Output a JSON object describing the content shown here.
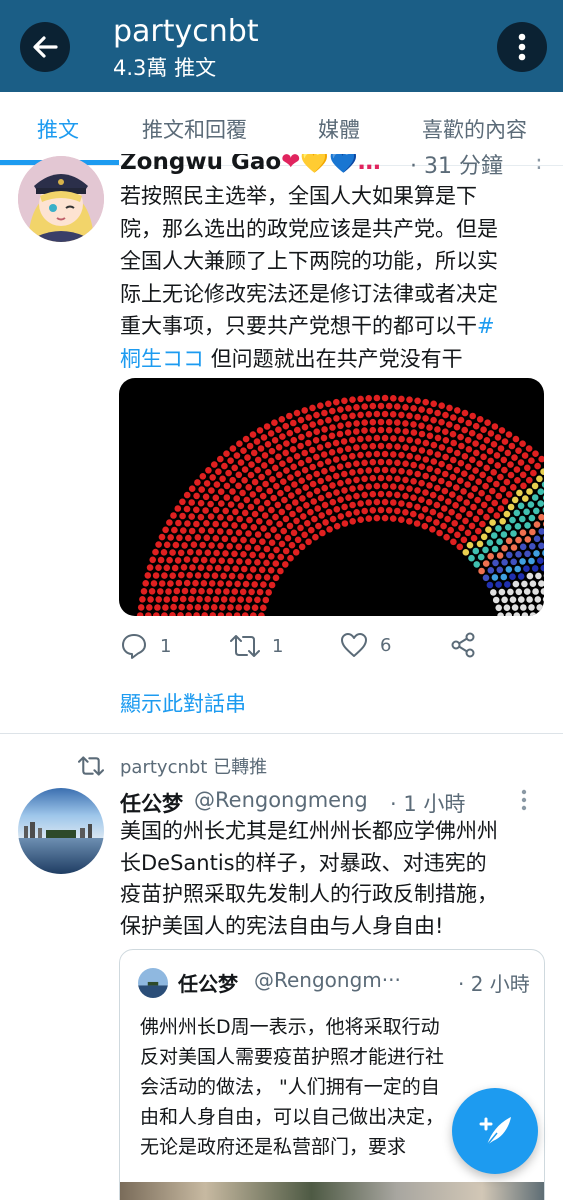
{
  "header": {
    "title": "partycnbt",
    "subtitle": "4.3萬 推文",
    "bg_color": "#1b5e86"
  },
  "tabs": [
    {
      "label": "推文",
      "active": true
    },
    {
      "label": "推文和回覆",
      "active": false
    },
    {
      "label": "媒體",
      "active": false
    },
    {
      "label": "喜歡的內容",
      "active": false
    }
  ],
  "accent_color": "#1d9bf0",
  "tweet1": {
    "name": "Zongwu Gao",
    "name_emojis": "❤💛💙…",
    "time": "· 31 分鐘",
    "text_lines": [
      "若按照民主选举，全国人大如果算是下",
      "院，那么选出的政党应该是共产党。但是",
      "全国人大兼顾了上下两院的功能，所以实",
      "际上无论修改宪法还是修订法律或者决定",
      "重大事项，只要共产党想干的都可以干"
    ],
    "hashtag_prefix": "#",
    "hashtag_word": "桐生ココ",
    "text_tail": "但问题就出在共产党没有干",
    "reply_count": "1",
    "retweet_count": "1",
    "like_count": "6",
    "show_thread": "顯示此對話串"
  },
  "tweet2": {
    "retweet_label": "partycnbt 已轉推",
    "name": "任公梦",
    "handle": "@Rengongmeng",
    "time": "· 1 小時",
    "text_lines": [
      "美国的州长尤其是红州州长都应学佛州州",
      "长DeSantis的样子，对暴政、对违宪的",
      "疫苗护照采取先发制人的行政反制措施，",
      "保护美国人的宪法自由与人身自由!"
    ],
    "quote": {
      "name": "任公梦",
      "handle": "@Rengongm···",
      "time": "· 2 小時",
      "text_lines": [
        "佛州州长D周一表示，他将采取行动",
        "反对美国人需要疫苗护照才能进行社",
        "会活动的做法， \"人们拥有一定的自",
        "由和人身自由，可以自己做出决定，",
        "无论是政府还是私营部门，要求"
      ]
    }
  },
  "icons": {
    "back": "arrow-left-icon",
    "more": "more-vertical-icon",
    "reply": "comment-icon",
    "retweet": "retweet-icon",
    "like": "heart-icon",
    "share": "share-icon",
    "compose": "compose-feather-icon"
  }
}
